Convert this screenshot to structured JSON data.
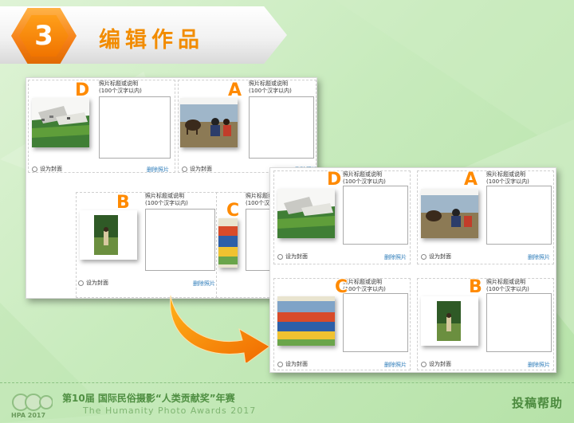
{
  "header": {
    "step_number": "3",
    "title": "编辑作品"
  },
  "card_text": {
    "caption_label_line1": "照片标题或说明",
    "caption_label_line2": "(100个汉字以内)",
    "cover_label": "设为封面",
    "delete_label": "删除照片"
  },
  "before_panel": {
    "cards": [
      {
        "letter": "D",
        "photo": "aerial-landscape-photo"
      },
      {
        "letter": "A",
        "photo": "farmer-with-ox-photo"
      },
      {
        "letter": "B",
        "photo": "portrait-forest-photo"
      },
      {
        "letter": "C",
        "photo": "crowd-festival-photo"
      }
    ]
  },
  "after_panel": {
    "cards": [
      {
        "letter": "D",
        "photo": "aerial-landscape-photo"
      },
      {
        "letter": "A",
        "photo": "farmer-with-ox-photo"
      },
      {
        "letter": "C",
        "photo": "crowd-festival-photo"
      },
      {
        "letter": "B",
        "photo": "portrait-forest-photo"
      }
    ]
  },
  "footer": {
    "logo_text": "HPA 2017",
    "title_cn": "第10届 国际民俗摄影“人类贡献奖”年赛",
    "title_en": "The Humanity Photo Awards 2017",
    "help_link": "投稿帮助"
  },
  "colors": {
    "accent_orange": "#f28c00",
    "link_blue": "#2a7ab8",
    "bg_green": "#c8ebbd"
  }
}
